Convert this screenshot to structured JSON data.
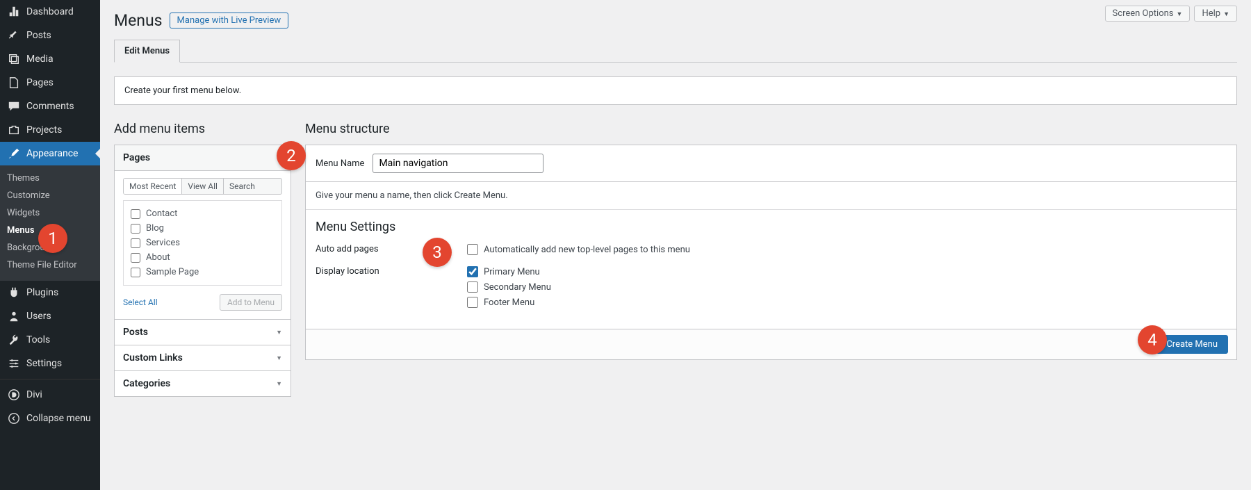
{
  "sidebar": {
    "items": [
      {
        "label": "Dashboard",
        "icon": "dashboard"
      },
      {
        "label": "Posts",
        "icon": "pin"
      },
      {
        "label": "Media",
        "icon": "media"
      },
      {
        "label": "Pages",
        "icon": "page"
      },
      {
        "label": "Comments",
        "icon": "comment"
      },
      {
        "label": "Projects",
        "icon": "portfolio"
      },
      {
        "label": "Appearance",
        "icon": "brush",
        "active": true
      },
      {
        "label": "Plugins",
        "icon": "plugin"
      },
      {
        "label": "Users",
        "icon": "user"
      },
      {
        "label": "Tools",
        "icon": "tools"
      },
      {
        "label": "Settings",
        "icon": "settings"
      },
      {
        "label": "Divi",
        "icon": "divi"
      },
      {
        "label": "Collapse menu",
        "icon": "collapse"
      }
    ],
    "sub": [
      {
        "label": "Themes"
      },
      {
        "label": "Customize"
      },
      {
        "label": "Widgets"
      },
      {
        "label": "Menus",
        "active": true
      },
      {
        "label": "Background"
      },
      {
        "label": "Theme File Editor"
      }
    ]
  },
  "top": {
    "screen_options": "Screen Options",
    "help": "Help"
  },
  "heading": "Menus",
  "manage_link": "Manage with Live Preview",
  "tab_label": "Edit Menus",
  "notice": "Create your first menu below.",
  "left": {
    "title": "Add menu items",
    "accordions": [
      {
        "title": "Pages",
        "open": true
      },
      {
        "title": "Posts"
      },
      {
        "title": "Custom Links"
      },
      {
        "title": "Categories"
      }
    ],
    "mini_tabs": [
      "Most Recent",
      "View All",
      "Search"
    ],
    "pages": [
      "Contact",
      "Blog",
      "Services",
      "About",
      "Sample Page"
    ],
    "select_all": "Select All",
    "add_to_menu": "Add to Menu"
  },
  "right": {
    "title": "Menu structure",
    "menu_name_label": "Menu Name",
    "menu_name_value": "Main navigation",
    "hint": "Give your menu a name, then click Create Menu.",
    "settings_heading": "Menu Settings",
    "auto_label": "Auto add pages",
    "auto_option": "Automatically add new top-level pages to this menu",
    "display_label": "Display location",
    "locations": [
      {
        "label": "Primary Menu",
        "checked": true
      },
      {
        "label": "Secondary Menu",
        "checked": false
      },
      {
        "label": "Footer Menu",
        "checked": false
      }
    ],
    "create_btn": "Create Menu"
  },
  "badges": [
    "1",
    "2",
    "3",
    "4"
  ]
}
